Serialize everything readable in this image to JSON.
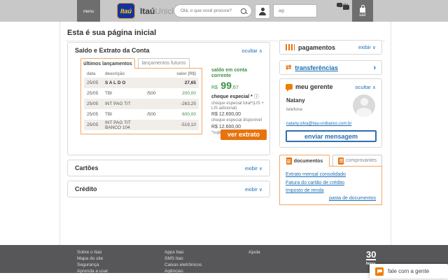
{
  "header": {
    "menu_label": "menu",
    "logo_text": "Itaú",
    "brand_bold": "Itaú",
    "brand_light": "Uniclass",
    "search_placeholder": "Olá, o que você procura?",
    "agency_placeholder": "ag:",
    "ajuda_label": "ajuda",
    "sair_label": "sair"
  },
  "page_title": "Esta é sua página inicial",
  "extrato": {
    "title": "Saldo e Extrato da Conta",
    "toggle_label": "ocultar",
    "tab_active": "últimos lançamentos",
    "tab_inactive": "lançamentos futuros",
    "table": {
      "col_data": "data",
      "col_desc": "descrição",
      "col_valor": "valor (R$)",
      "rows": [
        {
          "data": "25/05",
          "desc": "S A L D O",
          "ref": "",
          "valor": "27,65",
          "tone": "saldo"
        },
        {
          "data": "25/05",
          "desc": "TBI",
          "ref": "/500",
          "valor": "200,00",
          "tone": "positive"
        },
        {
          "data": "25/05",
          "desc": "INT PAG TIT",
          "ref": "",
          "valor": "-263,25",
          "tone": "negative"
        },
        {
          "data": "25/05",
          "desc": "TBI",
          "ref": "/500",
          "valor": "600,00",
          "tone": "positive"
        },
        {
          "data": "25/05",
          "desc": "INT PAG TIT BANCO 104",
          "ref": "",
          "valor": "-519,10",
          "tone": "negative"
        }
      ]
    },
    "summary": {
      "saldo_label": "saldo em conta corrente",
      "currency": "R$",
      "saldo_int": "99",
      "saldo_cents": ",67",
      "cheque_title": "cheque especial *",
      "cheque_total_label": "cheque especial total*(LIS + LIS adicional)",
      "cheque_total_value": "R$ 12.600,00",
      "cheque_disp_label": "cheque especial disponível",
      "cheque_disp_value": "R$ 12.600,00",
      "footnote": "*sujeito a encargos",
      "button_label": "ver extrato"
    }
  },
  "cartoes": {
    "title": "Cartões",
    "toggle_label": "exibir"
  },
  "credito": {
    "title": "Crédito",
    "toggle_label": "exibir"
  },
  "pagamentos": {
    "title": "pagamentos",
    "toggle_label": "exibir"
  },
  "transferencias": {
    "title": "transferências"
  },
  "gerente": {
    "title": "meu gerente",
    "toggle_label": "ocultar",
    "name": "Natany",
    "phone_label": "telefone",
    "email": "natany.silva@itau-unibanco.com.br",
    "button_label": "enviar mensagem"
  },
  "documentos": {
    "tab_active": "documentos",
    "tab_inactive": "comprovantes",
    "links": [
      "Extrato mensal consolidado",
      "Fatura do cartão de crédito",
      "Imposto de renda"
    ],
    "folder_link": "pasta de documentos"
  },
  "footer": {
    "col1": [
      "Sobre o Itaú",
      "Mapa do site",
      "Segurança",
      "Aprenda a usar"
    ],
    "col2": [
      "Apps Itaú",
      "SMS Itaú",
      "Caixas eletrônicos",
      "Agências"
    ],
    "col3": [
      "Ajuda"
    ],
    "logo_number": "30",
    "logo_word": "horas"
  },
  "chat": {
    "label": "fale com a gente"
  },
  "colors": {
    "orange": "#ec7000",
    "link_blue": "#1b6fb5",
    "green": "#3d8f42",
    "header_gray": "#c8c8c8",
    "footer_gray": "#57575a"
  }
}
